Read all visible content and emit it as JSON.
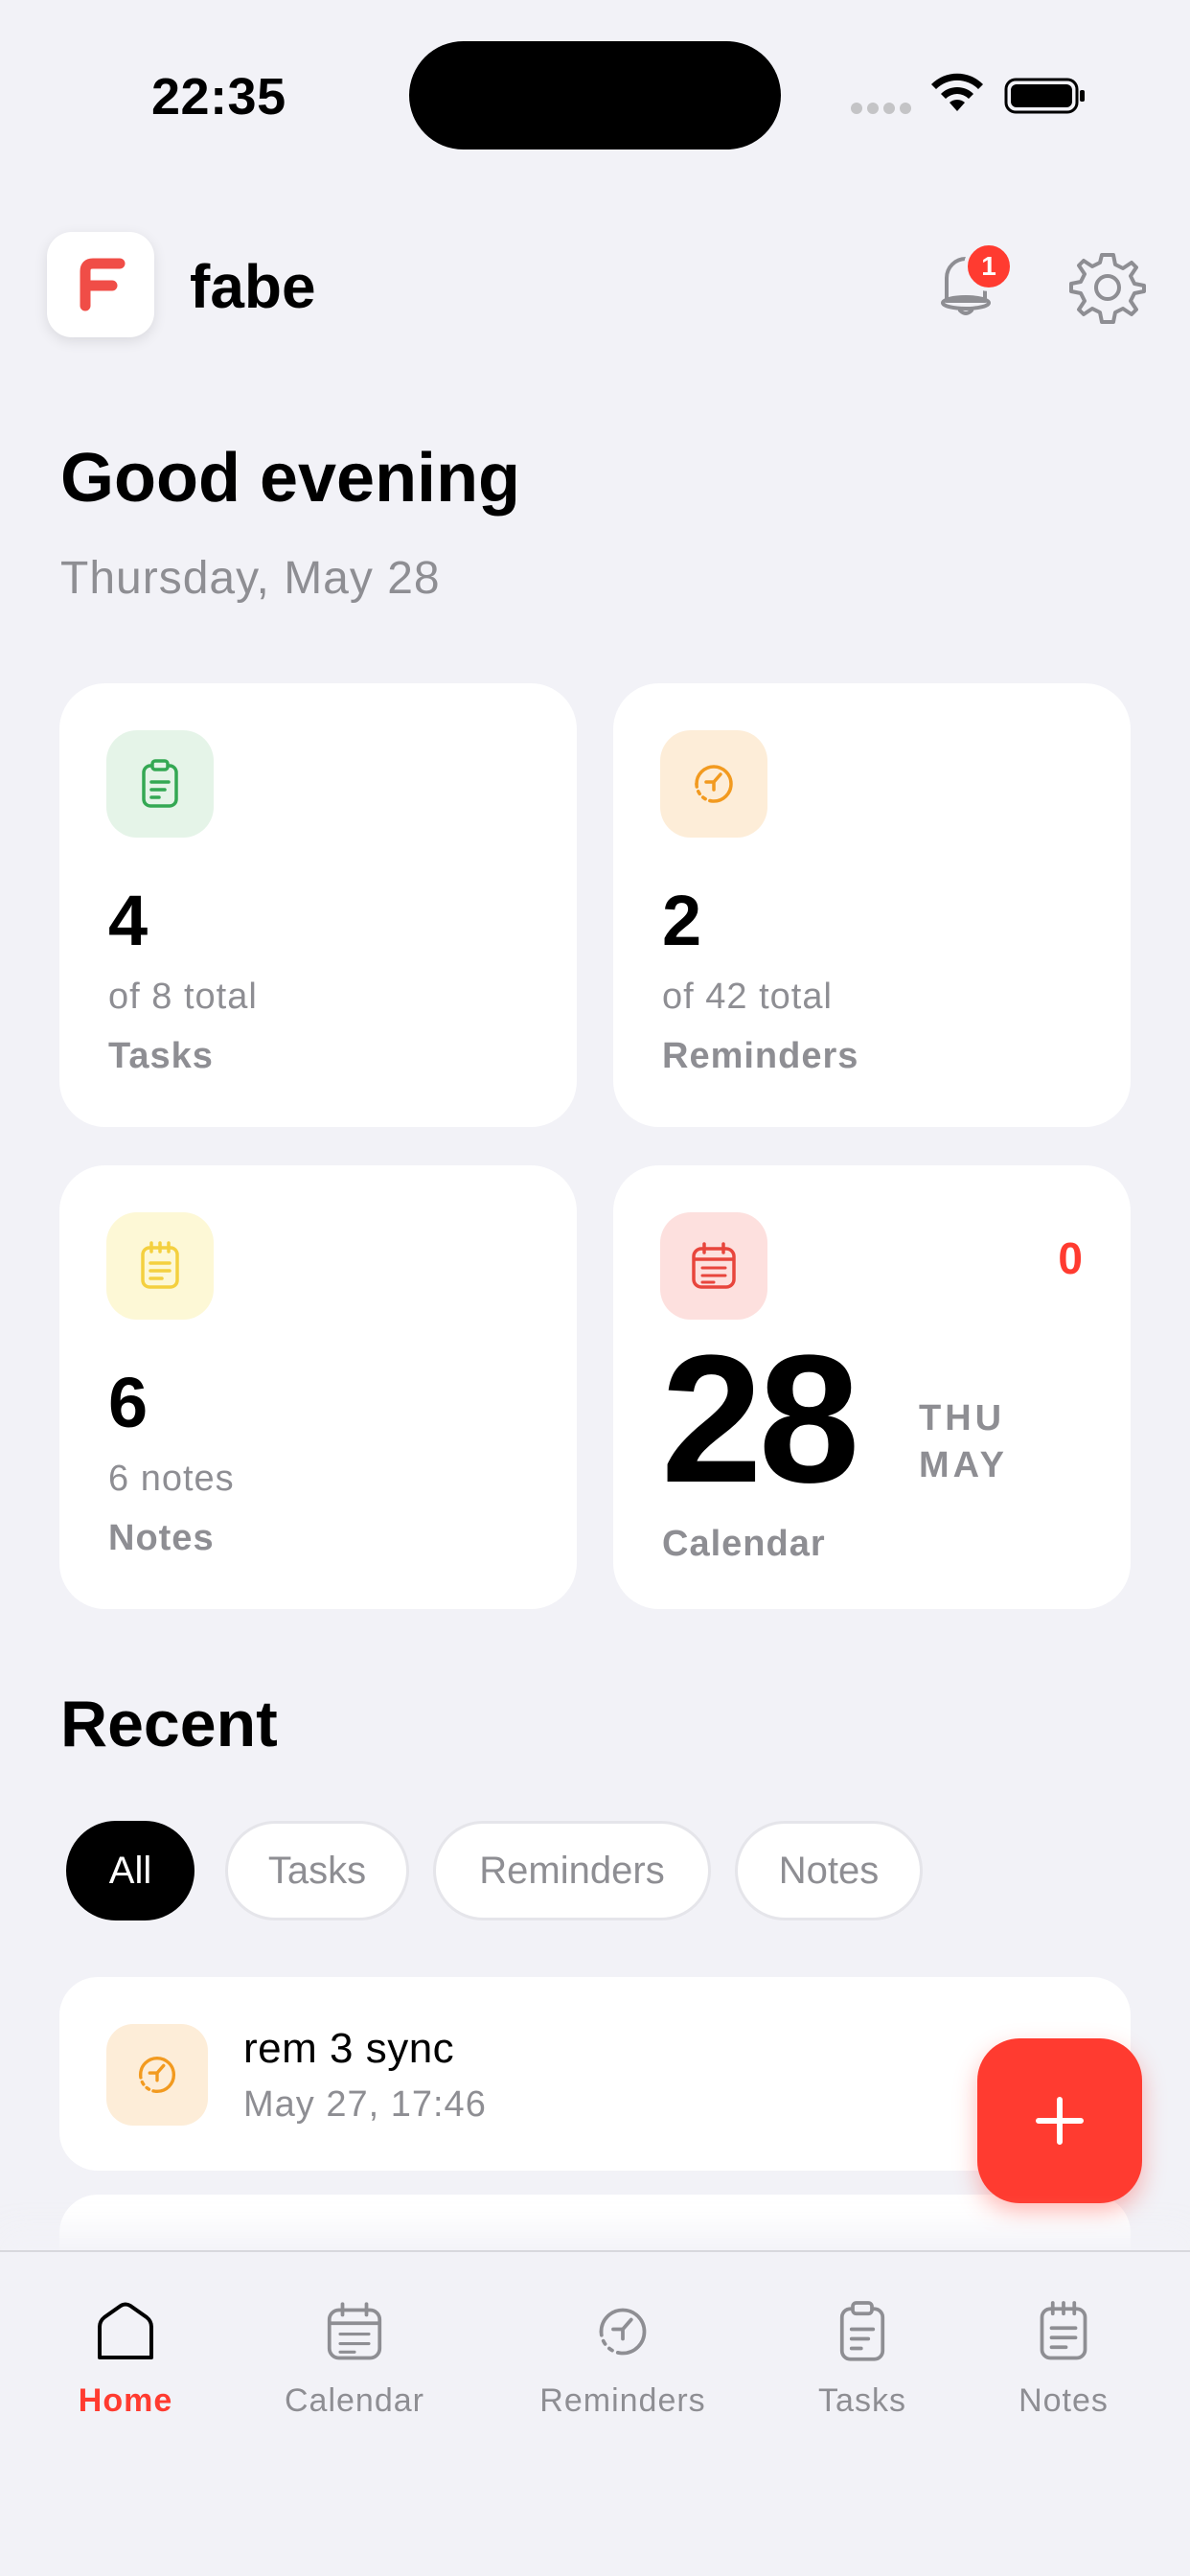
{
  "status_bar": {
    "time": "22:35"
  },
  "header": {
    "app_name": "fabe",
    "notification_count": "1"
  },
  "greeting": {
    "title": "Good evening",
    "date": "Thursday, May 28"
  },
  "cards": {
    "tasks": {
      "count": "4",
      "sub": "of 8 total",
      "label": "Tasks",
      "accent": "#34a853",
      "bg": "#e5f4e8"
    },
    "reminders": {
      "count": "2",
      "sub": "of 42 total",
      "label": "Reminders",
      "accent": "#f29a1f",
      "bg": "#fdedd8"
    },
    "notes": {
      "count": "6",
      "sub": "6 notes",
      "label": "Notes",
      "accent": "#f4d03f",
      "bg": "#fdf8d6"
    },
    "calendar": {
      "count": "0",
      "day": "28",
      "weekday": "THU",
      "month": "MAY",
      "label": "Calendar",
      "accent": "#e8453c",
      "bg": "#fde0de"
    }
  },
  "recent": {
    "title": "Recent",
    "filters": [
      "All",
      "Tasks",
      "Reminders",
      "Notes"
    ],
    "active_filter": "All",
    "items": [
      {
        "title": "rem 3 sync",
        "time": "May 27, 17:46",
        "icon": "reminder-icon"
      }
    ]
  },
  "fab": {
    "icon": "plus-icon"
  },
  "tabs": [
    {
      "label": "Home",
      "icon": "home-icon",
      "active": true
    },
    {
      "label": "Calendar",
      "icon": "calendar-icon",
      "active": false
    },
    {
      "label": "Reminders",
      "icon": "reminder-icon",
      "active": false
    },
    {
      "label": "Tasks",
      "icon": "clipboard-icon",
      "active": false
    },
    {
      "label": "Notes",
      "icon": "notepad-icon",
      "active": false
    }
  ],
  "colors": {
    "accent": "#ff3b30",
    "background": "#f2f2f7",
    "muted_text": "#8e8e93"
  }
}
